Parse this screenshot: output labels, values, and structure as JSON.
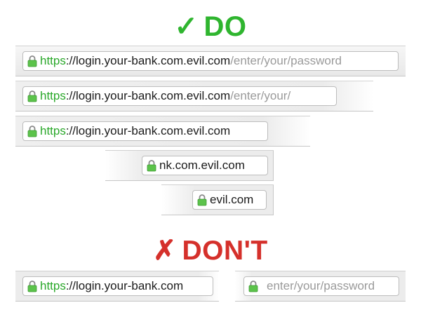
{
  "headings": {
    "do_mark": "✓",
    "do_text": "DO",
    "dont_mark": "✗",
    "dont_text": "DON'T"
  },
  "colors": {
    "do_green": "#2fb52f",
    "dont_red": "#d5302b",
    "scheme_green": "#2aa82a",
    "path_gray": "#9a9a9a",
    "lock_green": "#5cc34b"
  },
  "lock_icon": "padlock-icon",
  "do_bars": [
    {
      "scheme": "https",
      "host": "://login.your-bank.com.evil.com",
      "path": "/enter/your/password"
    },
    {
      "scheme": "https",
      "host": "://login.your-bank.com.evil.com",
      "path": "/enter/your/"
    },
    {
      "scheme": "https",
      "host": "://login.your-bank.com.evil.com",
      "path": ""
    },
    {
      "scheme": "",
      "host": "nk.com.evil.com",
      "path": ""
    },
    {
      "scheme": "",
      "host": "evil.com",
      "path": ""
    }
  ],
  "dont_bars": {
    "left": {
      "scheme": "https",
      "host": "://login.your-bank.com"
    },
    "right": {
      "placeholder": "enter/your/password"
    }
  }
}
